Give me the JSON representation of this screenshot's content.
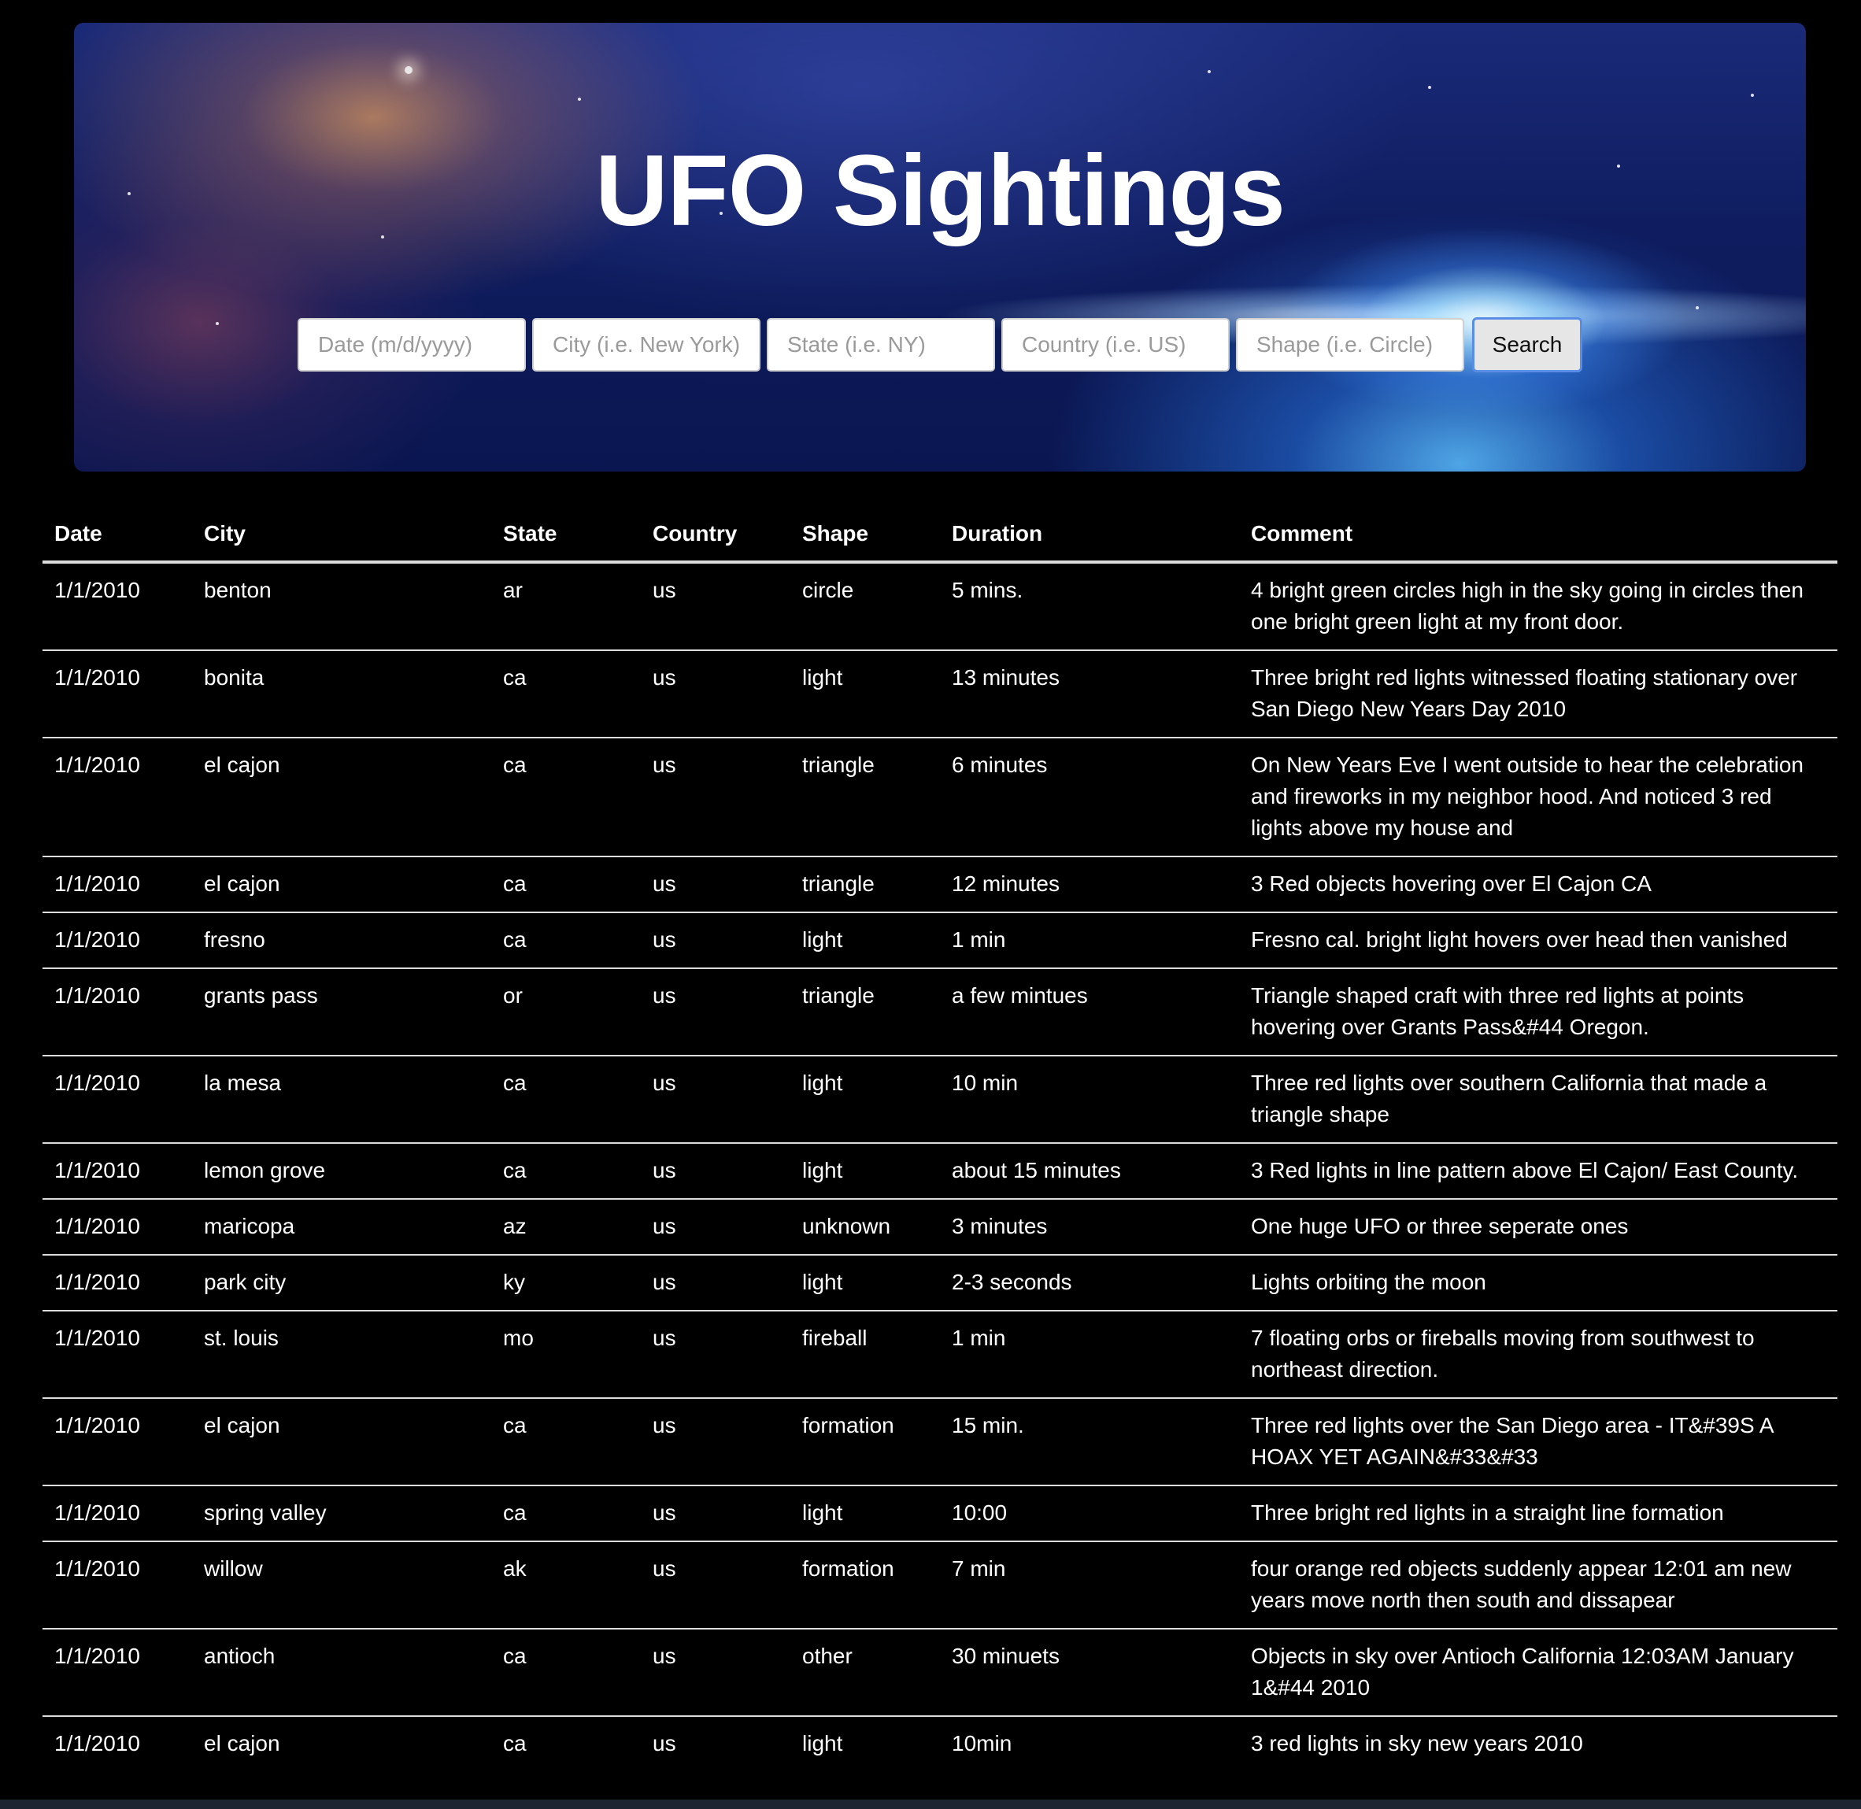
{
  "header": {
    "title": "UFO Sightings"
  },
  "search": {
    "date_placeholder": "Date (m/d/yyyy)",
    "city_placeholder": "City (i.e. New York)",
    "state_placeholder": "State (i.e. NY)",
    "country_placeholder": "Country (i.e. US)",
    "shape_placeholder": "Shape (i.e. Circle)",
    "button_label": "Search"
  },
  "table": {
    "columns": [
      "Date",
      "City",
      "State",
      "Country",
      "Shape",
      "Duration",
      "Comment"
    ],
    "rows": [
      [
        "1/1/2010",
        "benton",
        "ar",
        "us",
        "circle",
        "5 mins.",
        "4 bright green circles high in the sky going in circles then one bright green light at my front door."
      ],
      [
        "1/1/2010",
        "bonita",
        "ca",
        "us",
        "light",
        "13 minutes",
        "Three bright red lights witnessed floating stationary over San Diego New Years Day 2010"
      ],
      [
        "1/1/2010",
        "el cajon",
        "ca",
        "us",
        "triangle",
        "6 minutes",
        "On New Years Eve I went outside to hear the celebration and fireworks in my neighbor hood. And noticed 3 red lights above my house and"
      ],
      [
        "1/1/2010",
        "el cajon",
        "ca",
        "us",
        "triangle",
        "12 minutes",
        "3 Red objects hovering over El Cajon CA"
      ],
      [
        "1/1/2010",
        "fresno",
        "ca",
        "us",
        "light",
        "1 min",
        "Fresno cal. bright light hovers over head then vanished"
      ],
      [
        "1/1/2010",
        "grants pass",
        "or",
        "us",
        "triangle",
        "a few mintues",
        "Triangle shaped craft with three red lights at points hovering over Grants Pass&#44 Oregon."
      ],
      [
        "1/1/2010",
        "la mesa",
        "ca",
        "us",
        "light",
        "10 min",
        "Three red lights over southern California that made a triangle shape"
      ],
      [
        "1/1/2010",
        "lemon grove",
        "ca",
        "us",
        "light",
        "about 15 minutes",
        "3 Red lights in line pattern above El Cajon/ East County."
      ],
      [
        "1/1/2010",
        "maricopa",
        "az",
        "us",
        "unknown",
        "3 minutes",
        "One huge UFO or three seperate ones"
      ],
      [
        "1/1/2010",
        "park city",
        "ky",
        "us",
        "light",
        "2-3 seconds",
        "Lights orbiting the moon"
      ],
      [
        "1/1/2010",
        "st. louis",
        "mo",
        "us",
        "fireball",
        "1 min",
        "7 floating orbs or fireballs moving from southwest to northeast direction."
      ],
      [
        "1/1/2010",
        "el cajon",
        "ca",
        "us",
        "formation",
        "15 min.",
        "Three red lights over the San Diego area - IT&#39S A HOAX YET AGAIN&#33&#33"
      ],
      [
        "1/1/2010",
        "spring valley",
        "ca",
        "us",
        "light",
        "10:00",
        "Three bright red lights in a straight line formation"
      ],
      [
        "1/1/2010",
        "willow",
        "ak",
        "us",
        "formation",
        "7 min",
        "four orange red objects suddenly appear 12:01 am new years move north then south and dissapear"
      ],
      [
        "1/1/2010",
        "antioch",
        "ca",
        "us",
        "other",
        "30 minuets",
        "Objects in sky over Antioch California 12:03AM January 1&#44 2010"
      ],
      [
        "1/1/2010",
        "el cajon",
        "ca",
        "us",
        "light",
        "10min",
        "3 red lights in sky new years 2010"
      ]
    ]
  }
}
